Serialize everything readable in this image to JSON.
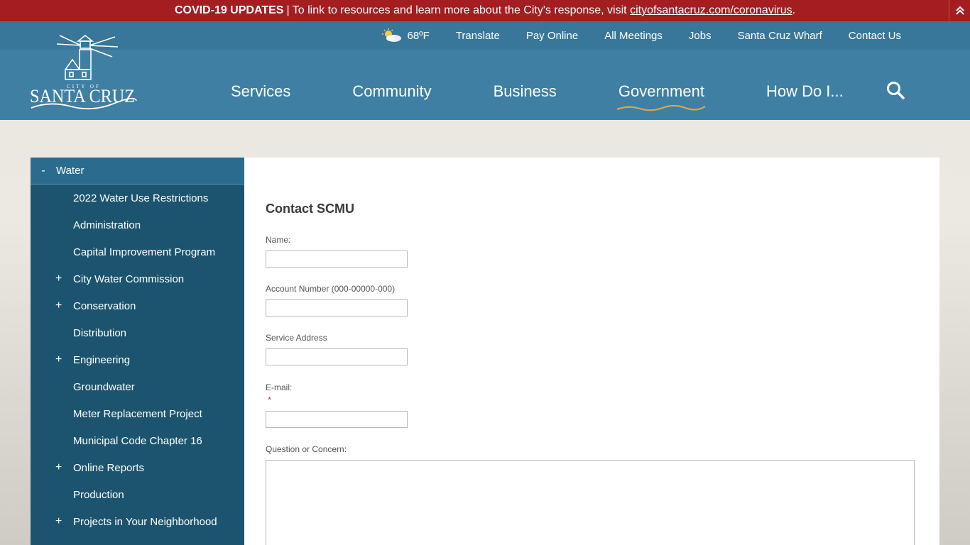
{
  "alert": {
    "bold": "COVID-19 UPDATES",
    "text": "| To link to resources and learn more about the City's response, visit",
    "link": "cityofsantacruz.com/coronavirus",
    "tail": "."
  },
  "logo": {
    "top": "CITY OF",
    "name": "SANTA CRUZ"
  },
  "utility": {
    "weather": "68ºF",
    "links": [
      "Translate",
      "Pay Online",
      "All Meetings",
      "Jobs",
      "Santa Cruz Wharf",
      "Contact Us"
    ]
  },
  "nav": {
    "items": [
      "Services",
      "Community",
      "Business",
      "Government",
      "How Do I..."
    ],
    "active": "Government",
    "accent": "#d4a94a"
  },
  "sidebar": {
    "head": "Water",
    "head_toggle": "-",
    "items": [
      {
        "label": "2022 Water Use Restrictions",
        "toggle": ""
      },
      {
        "label": "Administration",
        "toggle": ""
      },
      {
        "label": "Capital Improvement Program",
        "toggle": ""
      },
      {
        "label": "City Water Commission",
        "toggle": "+"
      },
      {
        "label": "Conservation",
        "toggle": "+"
      },
      {
        "label": "Distribution",
        "toggle": ""
      },
      {
        "label": "Engineering",
        "toggle": "+"
      },
      {
        "label": "Groundwater",
        "toggle": ""
      },
      {
        "label": "Meter Replacement Project",
        "toggle": ""
      },
      {
        "label": "Municipal Code Chapter 16",
        "toggle": ""
      },
      {
        "label": "Online Reports",
        "toggle": "+"
      },
      {
        "label": "Production",
        "toggle": ""
      },
      {
        "label": "Projects in Your Neighborhood",
        "toggle": "+"
      }
    ]
  },
  "form": {
    "title": "Contact SCMU",
    "name_label": "Name:",
    "account_label": "Account Number (000-00000-000)",
    "address_label": "Service Address",
    "email_label": "E-mail:",
    "required_mark": "*",
    "question_label": "Question or Concern:"
  },
  "colors": {
    "alert_bg": "#a41d21",
    "header_bg": "#3f7fa3",
    "sidebar_bg": "#1c546f"
  }
}
